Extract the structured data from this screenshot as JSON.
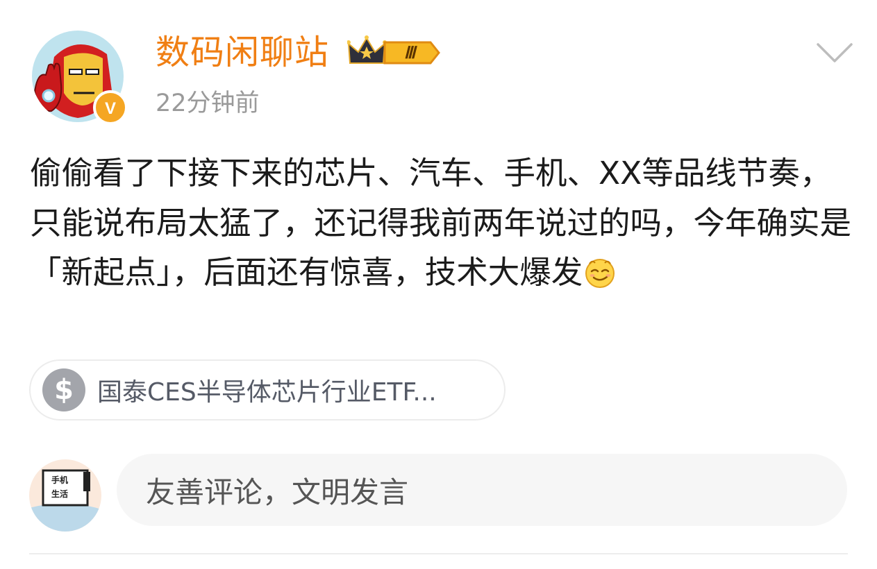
{
  "user": {
    "name": "数码闲聊站",
    "level": "Ⅲ",
    "timestamp": "22分钟前",
    "avatar_icon": "ironman-avatar-icon",
    "verified_mark": "V",
    "verified_icon": "verified-badge-icon"
  },
  "post": {
    "text": "偷偷看了下接下来的芯片、汽车、手机、XX等品线节奏，只能说布局太猛了，还记得我前两年说过的吗，今年确实是「新起点」，后面还有惊喜，技术大爆发",
    "emoji_icon": "smirk-emoji-icon"
  },
  "stock_tag": {
    "symbol": "$",
    "label": "国泰CES半导体芯片行业ETF..."
  },
  "comment": {
    "placeholder": "友善评论，文明发言",
    "avatar_text_line1": "手机",
    "avatar_text_line2": "生活"
  },
  "colors": {
    "username": "#f07f14",
    "timestamp": "#9a9a9a",
    "body_text": "#1b1b1b",
    "chip_icon_bg": "#a3a5ab",
    "comment_bg": "#f6f6f6"
  }
}
